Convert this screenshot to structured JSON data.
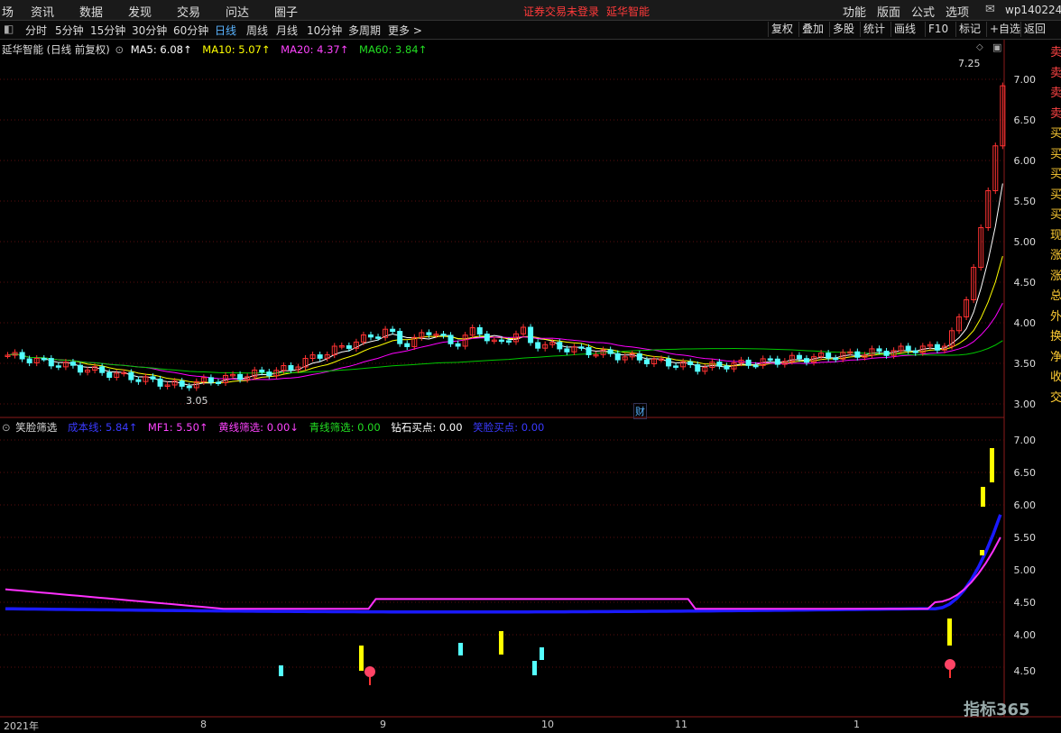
{
  "menu": {
    "left": [
      "场",
      "资讯",
      "数据",
      "发现",
      "交易",
      "问达",
      "圈子"
    ],
    "center_status": "证券交易未登录",
    "center_stock": "延华智能",
    "right": [
      "功能",
      "版面",
      "公式",
      "选项"
    ],
    "user": "wp140224"
  },
  "toolbar": {
    "tabs": [
      "分时",
      "5分钟",
      "15分钟",
      "30分钟",
      "60分钟",
      "日线",
      "周线",
      "月线",
      "10分钟",
      "多周期",
      "更多 >"
    ],
    "active_tab": "日线",
    "right_buttons": [
      "复权",
      "叠加",
      "多股",
      "统计",
      "画线",
      "F10",
      "标记",
      "+自选",
      "返回"
    ]
  },
  "main_pane": {
    "title": "延华智能 (日线 前复权)",
    "ma5": "MA5: 6.08↑",
    "ma10": "MA10: 5.07↑",
    "ma20": "MA20: 4.37↑",
    "ma60": "MA60: 3.84↑",
    "high_label": "7.25",
    "low_label": "3.05",
    "cai_label": "财",
    "axis": [
      "7.00",
      "6.50",
      "6.00",
      "5.50",
      "5.00",
      "4.50",
      "4.00",
      "3.50",
      "3.00"
    ],
    "side_chars": [
      "卖",
      "卖",
      "卖",
      "卖",
      "买",
      "买",
      "买",
      "买",
      "买",
      "现",
      "涨",
      "涨",
      "总",
      "外",
      "换",
      "净",
      "收",
      "交"
    ]
  },
  "sub_pane": {
    "title": "笑脸筛选",
    "cost": "成本线: 5.84↑",
    "mf1": "MF1: 5.50↑",
    "yellow": "黄线筛选: 0.00↓",
    "cyan": "青线筛选: 0.00",
    "diamond": "钻石买点: 0.00",
    "smile": "笑脸买点: 0.00",
    "axis": [
      "7.00",
      "6.50",
      "6.00",
      "5.50",
      "5.00",
      "4.50",
      "4.00",
      "4.50"
    ]
  },
  "dates": [
    "2021年",
    "8",
    "9",
    "10",
    "11",
    "1"
  ],
  "watermark": "指标365",
  "colors": {
    "up": "#ff3232",
    "down": "#54ffff",
    "ma5": "#ffffff",
    "ma10": "#ffff00",
    "ma20": "#ff00ff",
    "ma60": "#00c800",
    "cost": "#1a1aff",
    "mf1": "#ff30ff"
  }
}
